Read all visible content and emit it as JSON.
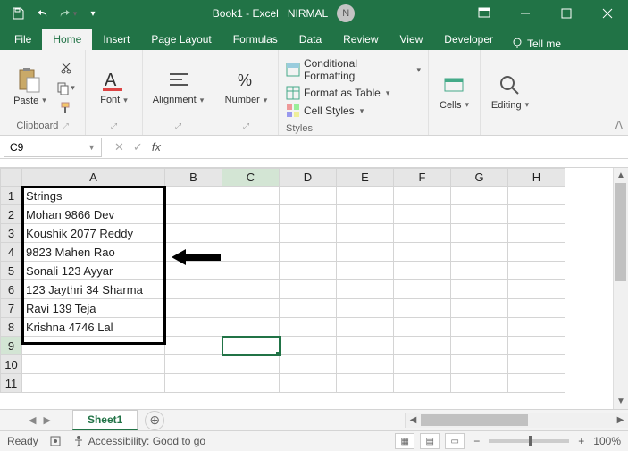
{
  "titlebar": {
    "doc_title": "Book1 - Excel",
    "user_name": "NIRMAL",
    "user_initial": "N"
  },
  "tabs": {
    "file": "File",
    "home": "Home",
    "insert": "Insert",
    "pagelayout": "Page Layout",
    "formulas": "Formulas",
    "data": "Data",
    "review": "Review",
    "view": "View",
    "developer": "Developer",
    "tellme": "Tell me"
  },
  "ribbon": {
    "paste": "Paste",
    "clipboard": "Clipboard",
    "font": "Font",
    "alignment": "Alignment",
    "number": "Number",
    "cond_fmt": "Conditional Formatting",
    "fmt_table": "Format as Table",
    "cell_styles": "Cell Styles",
    "styles": "Styles",
    "cells": "Cells",
    "editing": "Editing"
  },
  "namebox": "C9",
  "columns": [
    "A",
    "B",
    "C",
    "D",
    "E",
    "F",
    "G",
    "H"
  ],
  "rows": [
    "1",
    "2",
    "3",
    "4",
    "5",
    "6",
    "7",
    "8",
    "9",
    "10",
    "11"
  ],
  "cells": {
    "A1": "Strings",
    "A2": "Mohan 9866 Dev",
    "A3": "Koushik 2077 Reddy",
    "A4": "9823 Mahen  Rao",
    "A5": "Sonali 123 Ayyar",
    "A6": "123 Jaythri 34 Sharma",
    "A7": "Ravi 139 Teja",
    "A8": "Krishna 4746 Lal"
  },
  "sheet": {
    "name": "Sheet1"
  },
  "status": {
    "ready": "Ready",
    "accessibility": "Accessibility: Good to go",
    "zoom": "100%"
  }
}
